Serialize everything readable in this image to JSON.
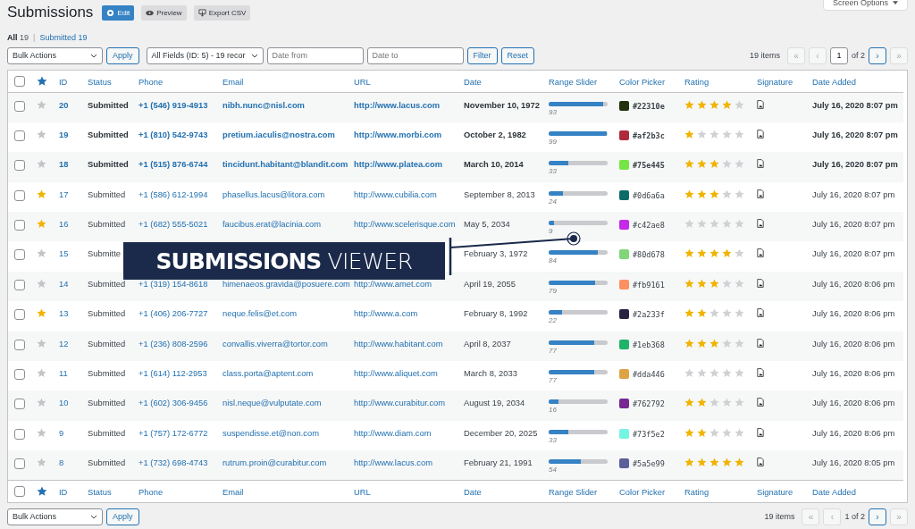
{
  "page_title": "Submissions",
  "header_buttons": [
    {
      "kind": "edit",
      "label": "Edit"
    },
    {
      "kind": "preview",
      "label": "Preview"
    },
    {
      "kind": "export",
      "label": "Export CSV"
    }
  ],
  "screen_options": "Screen Options",
  "filters": [
    {
      "label": "All",
      "count": "19",
      "selected": true
    },
    {
      "separator": "|",
      "label": "Submitted",
      "count": "19",
      "selected": false
    }
  ],
  "top_toolbar": {
    "bulk_actions": "Bulk Actions",
    "apply": "Apply",
    "field_select": "All Fields (ID: 5) - 19 recor",
    "date_from": {
      "placeholder": "Date from"
    },
    "date_to": {
      "placeholder": "Date to"
    },
    "filter": "Filter",
    "reset": "Reset",
    "items": "19 items",
    "pagination": {
      "first": {
        "label": "«",
        "disabled": true
      },
      "prev": {
        "label": "‹",
        "disabled": true
      },
      "page": "1",
      "of": "of 2",
      "next": {
        "label": "›",
        "disabled": false
      },
      "last": {
        "label": "»",
        "disabled": true
      }
    }
  },
  "select_all": {
    "checked": false
  },
  "columns": [
    "ID",
    "Status",
    "Phone",
    "Email",
    "URL",
    "Date",
    "Range Slider",
    "Color Picker",
    "Rating",
    "Signature",
    "Date Added"
  ],
  "rows": [
    {
      "id": "20",
      "starred": false,
      "unread": true,
      "status": "Submitted",
      "phone": "+1 (546) 919-4913",
      "email": "nibh.nunc@nisl.com",
      "url": "http://www.lacus.com",
      "date": "November 10, 1972",
      "level": 0.93,
      "reading": "93",
      "color": "#22310e",
      "hex": "#22310e",
      "stars": 4,
      "date_added": "July 16, 2020 8:07 pm"
    },
    {
      "id": "19",
      "starred": false,
      "unread": true,
      "status": "Submitted",
      "phone": "+1 (810) 542-9743",
      "email": "pretium.iaculis@nostra.com",
      "url": "http://www.morbi.com",
      "date": "October 2, 1982",
      "level": 0.99,
      "reading": "99",
      "color": "#af2b3c",
      "hex": "#af2b3c",
      "stars": 1,
      "date_added": "July 16, 2020 8:07 pm"
    },
    {
      "id": "18",
      "starred": false,
      "unread": true,
      "status": "Submitted",
      "phone": "+1 (515) 876-6744",
      "email": "tincidunt.habitant@blandit.com",
      "url": "http://www.platea.com",
      "date": "March 10, 2014",
      "level": 0.33,
      "reading": "33",
      "color": "#75e445",
      "hex": "#75e445",
      "stars": 3,
      "date_added": "July 16, 2020 8:07 pm"
    },
    {
      "id": "17",
      "starred": true,
      "unread": false,
      "status": "Submitted",
      "phone": "+1 (586) 612-1994",
      "email": "phasellus.lacus@litora.com",
      "url": "http://www.cubilia.com",
      "date": "September 8, 2013",
      "level": 0.24,
      "reading": "24",
      "color": "#0d6a6a",
      "hex": "#0d6a6a",
      "stars": 3,
      "date_added": "July 16, 2020 8:07 pm"
    },
    {
      "id": "16",
      "starred": true,
      "unread": false,
      "status": "Submitted",
      "phone": "+1 (682) 555-5021",
      "email": "faucibus.erat@lacinia.com",
      "url": "http://www.scelerisque.com",
      "date": "May 5, 2034",
      "level": 0.09,
      "reading": "9",
      "color": "#c42ae8",
      "hex": "#c42ae8",
      "stars": 0,
      "date_added": "July 16, 2020 8:07 pm"
    },
    {
      "id": "15",
      "starred": false,
      "unread": false,
      "status": "Submitte",
      "date": "February 3, 1972",
      "level": 0.84,
      "reading": "84",
      "color": "#80d678",
      "hex": "#80d678",
      "stars": 4,
      "date_added": "July 16, 2020 8:07 pm"
    },
    {
      "id": "14",
      "starred": false,
      "unread": false,
      "status": "Submitted",
      "phone": "+1 (319) 154-8618",
      "email": "himenaeos.gravida@posuere.com",
      "url": "http://www.amet.com",
      "date": "April 19, 2055",
      "level": 0.79,
      "reading": "79",
      "color": "#fb9161",
      "hex": "#fb9161",
      "stars": 3,
      "date_added": "July 16, 2020 8:06 pm"
    },
    {
      "id": "13",
      "starred": true,
      "unread": false,
      "status": "Submitted",
      "phone": "+1 (406) 206-7727",
      "email": "neque.felis@et.com",
      "url": "http://www.a.com",
      "date": "February 8, 1992",
      "level": 0.22,
      "reading": "22",
      "color": "#2a233f",
      "hex": "#2a233f",
      "stars": 2,
      "date_added": "July 16, 2020 8:06 pm"
    },
    {
      "id": "12",
      "starred": false,
      "unread": false,
      "status": "Submitted",
      "phone": "+1 (236) 808-2596",
      "email": "convallis.viverra@tortor.com",
      "url": "http://www.habitant.com",
      "date": "April 8, 2037",
      "level": 0.77,
      "reading": "77",
      "color": "#1eb368",
      "hex": "#1eb368",
      "stars": 3,
      "date_added": "July 16, 2020 8:06 pm"
    },
    {
      "id": "11",
      "starred": false,
      "unread": false,
      "status": "Submitted",
      "phone": "+1 (614) 112-2953",
      "email": "class.porta@aptent.com",
      "url": "http://www.aliquet.com",
      "date": "March 8, 2033",
      "level": 0.77,
      "reading": "77",
      "color": "#dda446",
      "hex": "#dda446",
      "stars": 0,
      "date_added": "July 16, 2020 8:06 pm"
    },
    {
      "id": "10",
      "starred": false,
      "unread": false,
      "status": "Submitted",
      "phone": "+1 (602) 306-9456",
      "email": "nisl.neque@vulputate.com",
      "url": "http://www.curabitur.com",
      "date": "August 19, 2034",
      "level": 0.16,
      "reading": "16",
      "color": "#762792",
      "hex": "#762792",
      "stars": 2,
      "date_added": "July 16, 2020 8:06 pm"
    },
    {
      "id": "9",
      "starred": false,
      "unread": false,
      "status": "Submitted",
      "phone": "+1 (757) 172-6772",
      "email": "suspendisse.et@non.com",
      "url": "http://www.diam.com",
      "date": "December 20, 2025",
      "level": 0.33,
      "reading": "33",
      "color": "#73f5e2",
      "hex": "#73f5e2",
      "stars": 2,
      "date_added": "July 16, 2020 8:06 pm"
    },
    {
      "id": "8",
      "starred": false,
      "unread": false,
      "status": "Submitted",
      "phone": "+1 (732) 698-4743",
      "email": "rutrum.proin@curabitur.com",
      "url": "http://www.lacus.com",
      "date": "February 21, 1991",
      "level": 0.54,
      "reading": "54",
      "color": "#5a5e99",
      "hex": "#5a5e99",
      "stars": 5,
      "date_added": "July 16, 2020 8:05 pm"
    }
  ],
  "footer_select_all": {
    "checked": false
  },
  "footer_columns": [
    "ID",
    "Status",
    "Phone",
    "Email",
    "URL",
    "Date",
    "Range Slider",
    "Color Picker",
    "Rating",
    "Signature",
    "Date Added"
  ],
  "bottom_toolbar": {
    "bulk_actions": "Bulk Actions",
    "apply": "Apply",
    "items": "19 items",
    "pagination": {
      "first": {
        "label": "«",
        "disabled": true
      },
      "prev": {
        "label": "‹",
        "disabled": true
      },
      "page_text": "1 of 2",
      "next": {
        "label": "›",
        "disabled": false
      },
      "last": {
        "label": "»",
        "disabled": true
      }
    }
  },
  "callout": {
    "title": "SUBMISSIONS",
    "subtitle": "VIEWER"
  }
}
